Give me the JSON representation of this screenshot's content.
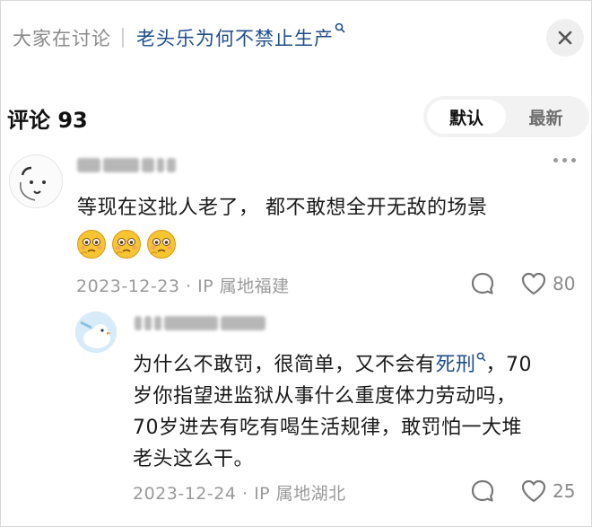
{
  "header": {
    "label": "大家在讨论",
    "topic": "老头乐为何不禁止生产",
    "search_glyph": "Q"
  },
  "comments_section": {
    "title": "评论 93",
    "sort_options": {
      "default": "默认",
      "latest": "最新"
    }
  },
  "comments": [
    {
      "text": "等现在这批人老了， 都不敢想全开无敌的场景",
      "emoji_count": 3,
      "date": "2023-12-23",
      "location": "IP 属地福建",
      "likes": "80"
    },
    {
      "text_prefix": "为什么不敢罚，很简单，又不会有",
      "text_link": "死刑",
      "text_suffix_line1": "，70",
      "line2": "岁你指望进监狱从事什么重度体力劳动吗，",
      "line3": "70岁进去有吃有喝生活规律，敢罚怕一大堆",
      "line4": "老头这么干。",
      "date": "2023-12-24",
      "location": "IP 属地湖北",
      "likes": "25"
    }
  ],
  "separator": "·",
  "colors": {
    "link": "#1f4d8a",
    "muted": "#9a9a9a",
    "toggle_bg": "#f2f2f2"
  }
}
